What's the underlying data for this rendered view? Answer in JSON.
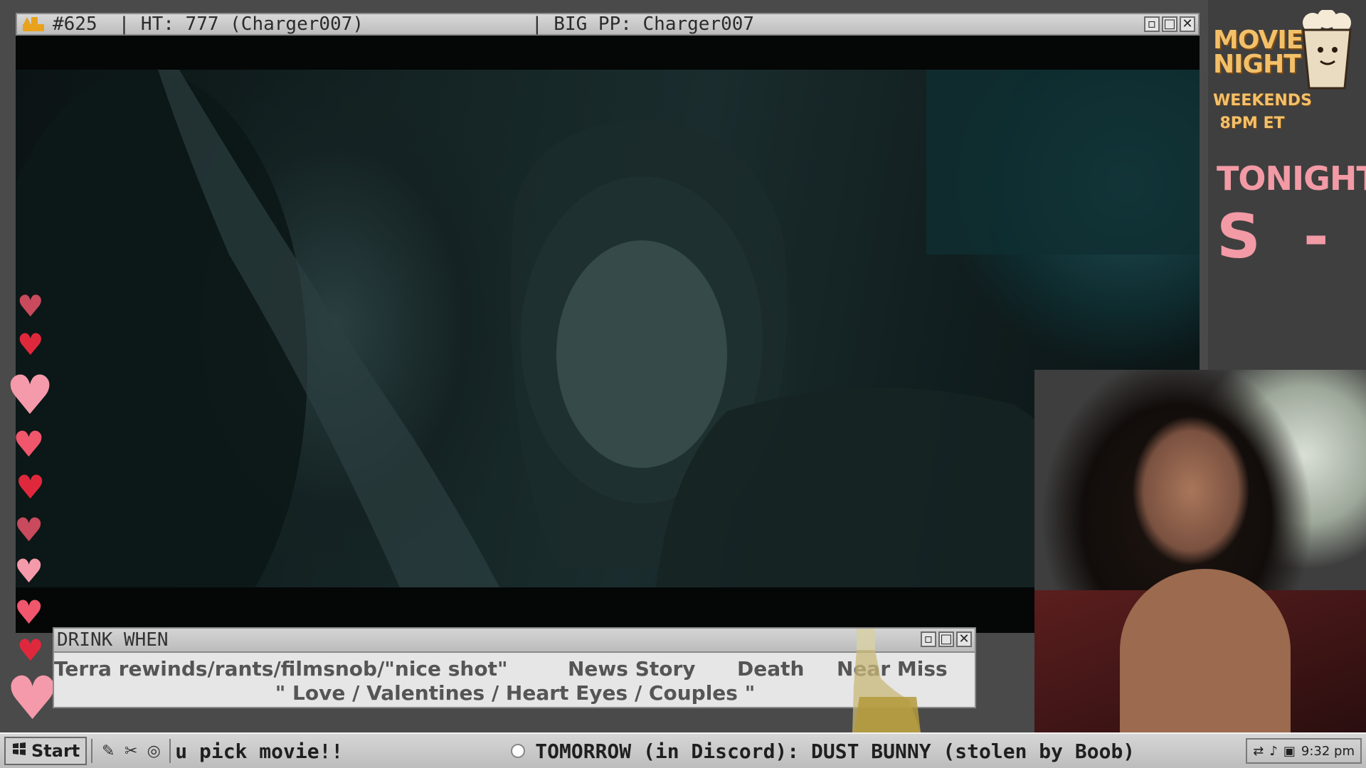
{
  "header": {
    "rank_text": "#625",
    "ht_text": "| HT: 777 (Charger007)",
    "bigpp_text": "| BIG PP: Charger007",
    "buttons": {
      "minimize": "▫",
      "maximize": "□",
      "close": "✕"
    }
  },
  "sidebar": {
    "title_line1": "MOVIE",
    "title_line2": "NIGHT",
    "schedule_line1": "WEEKENDS",
    "schedule_line2": "8PM ET",
    "tonight_label": "TONIGHT:",
    "tonight_marquee": "S  -  I"
  },
  "drink_panel": {
    "title": "DRINK WHEN",
    "rule1": "Terra rewinds/rants/filmsnob/\"nice shot\"",
    "rule2": "News Story",
    "rule3": "Death",
    "rule4": "Near Miss",
    "rule5": "\" Love / Valentines / Heart Eyes / Couples \""
  },
  "taskbar": {
    "start_label": "Start",
    "prompt_text": "u pick movie!!",
    "announcement": "TOMORROW (in Discord): DUST BUNNY (stolen by Boob)",
    "clock": "9:32 pm"
  },
  "colors": {
    "accent_gold": "#e8a21c",
    "heart_red": "#e24a63",
    "tonight_pink": "#f29aa5",
    "movie_night_yellow": "#f3c06a"
  }
}
